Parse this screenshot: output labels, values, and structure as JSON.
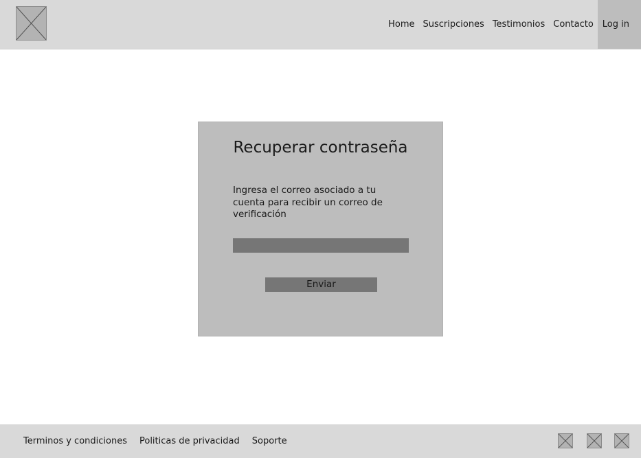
{
  "header": {
    "logo_icon": "image-placeholder-icon",
    "nav": [
      {
        "label": "Home"
      },
      {
        "label": "Suscripciones"
      },
      {
        "label": "Testimonios"
      },
      {
        "label": "Contacto"
      },
      {
        "label": "Log in"
      }
    ]
  },
  "recover": {
    "title": "Recuperar contraseña",
    "description": "Ingresa el correo asociado a tu cuenta para recibir un correo de verificación",
    "email_value": "",
    "submit_label": "Enviar"
  },
  "footer": {
    "links": [
      {
        "label": "Terminos y condiciones"
      },
      {
        "label": "Politicas de privacidad"
      },
      {
        "label": "Soporte"
      }
    ],
    "social_icons": [
      "image-placeholder-icon",
      "image-placeholder-icon",
      "image-placeholder-icon"
    ]
  },
  "colors": {
    "header_bg": "#d9d9d9",
    "card_bg": "#bdbdbd",
    "field_bg": "#767676",
    "placeholder_bg": "#b3b3b3"
  }
}
